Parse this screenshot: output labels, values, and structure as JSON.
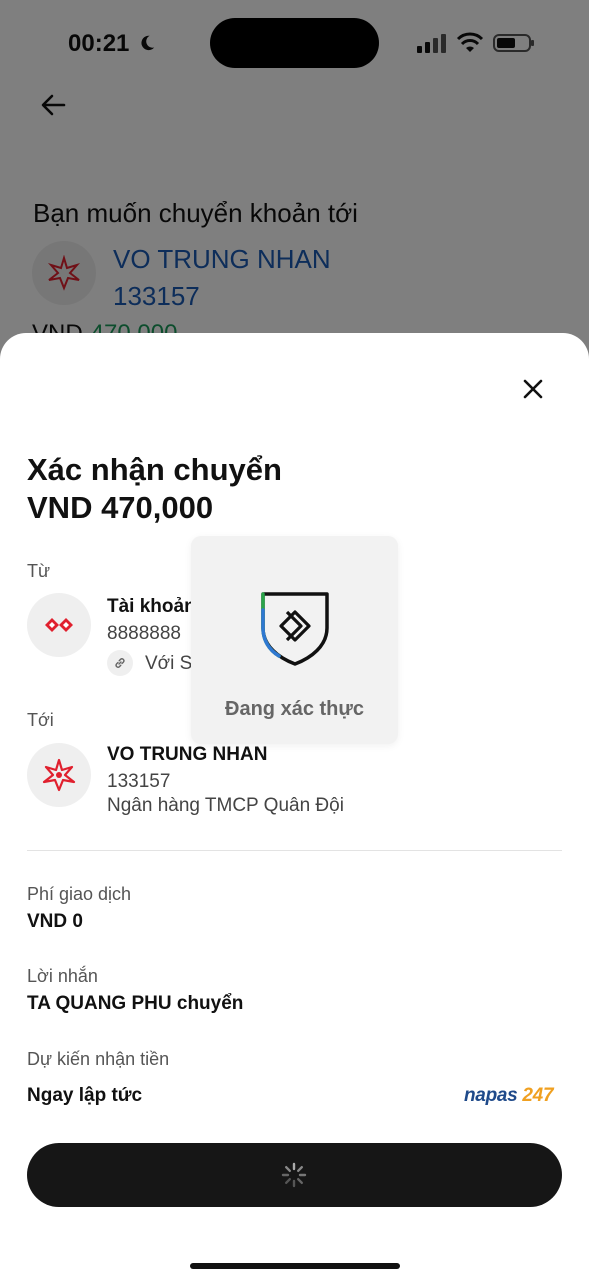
{
  "status_bar": {
    "time": "00:21",
    "icons": [
      "moon-icon",
      "signal-icon",
      "wifi-icon",
      "battery-icon"
    ]
  },
  "background_screen": {
    "title": "Bạn muốn chuyển khoản tới",
    "recipient_name": "VO TRUNG NHAN",
    "recipient_account": "133157",
    "amount_currency": "VND",
    "amount_value": "470,000"
  },
  "sheet": {
    "title": "Xác nhận chuyển",
    "amount": "VND 470,000",
    "from": {
      "label": "Từ",
      "account_name": "Tài khoản",
      "account_number": "8888888",
      "linked_text": "Với S"
    },
    "to": {
      "label": "Tới",
      "name": "VO TRUNG NHAN",
      "account_number": "133157",
      "bank": "Ngân hàng TMCP Quân Đội"
    },
    "fee": {
      "label": "Phí giao dịch",
      "value": "VND 0"
    },
    "message": {
      "label": "Lời nhắn",
      "value": "TA QUANG PHU chuyển"
    },
    "eta": {
      "label": "Dự kiến nhận tiền",
      "value": "Ngay lập tức"
    },
    "napas": {
      "part1": "napas ",
      "part2": "247"
    }
  },
  "verifying": {
    "text": "Đang xác thực"
  },
  "colors": {
    "accent_blue": "#1a5bb5",
    "amount_green": "#1a9a5a",
    "brand_red": "#e0202e",
    "button_dark": "#161616"
  }
}
